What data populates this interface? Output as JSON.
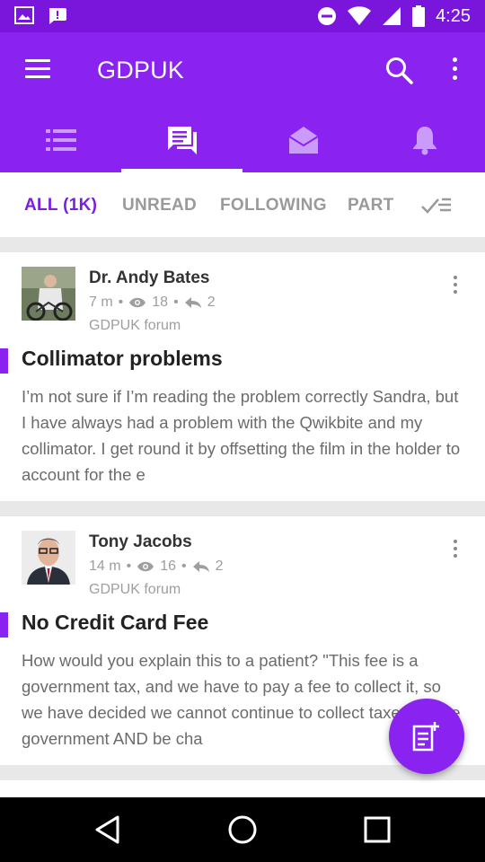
{
  "status_bar": {
    "time": "4:25",
    "icons": [
      "image-notification-icon",
      "chat-notification-icon",
      "do-not-disturb-icon",
      "wifi-icon",
      "signal-icon",
      "battery-icon"
    ]
  },
  "app_bar": {
    "title": "GDPUK",
    "icons": [
      "menu-icon",
      "search-icon",
      "more-vert-icon"
    ]
  },
  "icon_tabs": [
    {
      "icon": "list-icon",
      "active": false
    },
    {
      "icon": "forum-chat-icon",
      "active": true
    },
    {
      "icon": "mail-open-icon",
      "active": false
    },
    {
      "icon": "bell-icon",
      "active": false
    }
  ],
  "filters": [
    {
      "label": "ALL (1K)",
      "active": true
    },
    {
      "label": "UNREAD",
      "active": false
    },
    {
      "label": "FOLLOWING",
      "active": false
    },
    {
      "label": "PART",
      "active": false
    }
  ],
  "posts": [
    {
      "author": "Dr. Andy Bates",
      "time": "7 m",
      "views": "18",
      "replies": "2",
      "forum": "GDPUK forum",
      "subject": "Collimator problems",
      "body": "I’m not sure if I’m reading the problem correctly Sandra, but I have always had a problem with the Qwikbite and my collimator. I get round it by offsetting the film in the holder to account for the e"
    },
    {
      "author": "Tony Jacobs",
      "time": "14 m",
      "views": "16",
      "replies": "2",
      "forum": "GDPUK forum",
      "subject": "No Credit Card Fee",
      "body": "How would you explain this to a patient? \"This fee is a government tax, and we have to pay a fee to collect it, so we have decided we cannot continue to collect taxes for the government AND be cha"
    }
  ],
  "fab": {
    "icon": "new-post-icon"
  },
  "colors": {
    "primary": "#8a22f0",
    "primary_dark": "#7a16dc",
    "accent_text": "#7a1fe0"
  }
}
